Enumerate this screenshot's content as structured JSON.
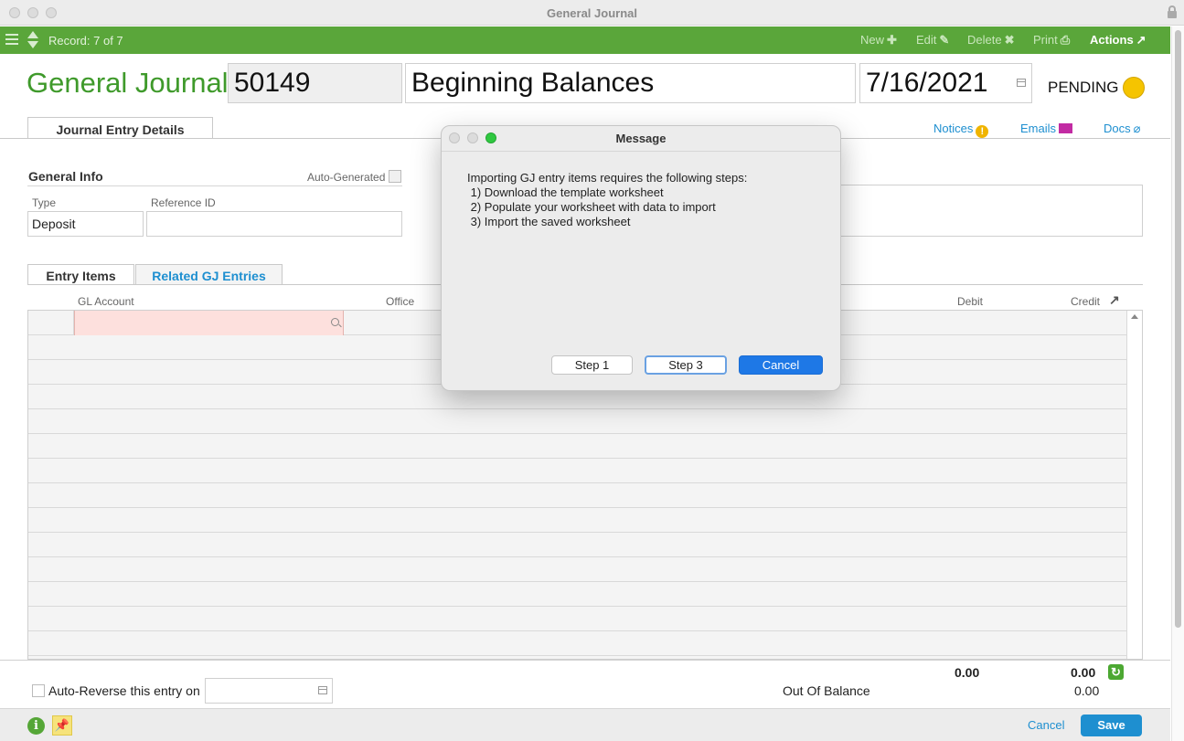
{
  "window": {
    "title": "General Journal"
  },
  "toolbar": {
    "record": "Record: 7 of 7",
    "new": "New",
    "edit": "Edit",
    "delete": "Delete",
    "print": "Print",
    "actions": "Actions"
  },
  "header": {
    "label": "General Journal:",
    "number": "50149",
    "description": "Beginning Balances",
    "date": "7/16/2021",
    "status": "PENDING",
    "status_color": "#f5c400"
  },
  "tabs": {
    "main": "Journal Entry Details"
  },
  "links": {
    "notices": "Notices",
    "emails": "Emails",
    "docs": "Docs"
  },
  "general_info": {
    "title": "General Info",
    "auto_generated_label": "Auto-Generated",
    "type_label": "Type",
    "type_value": "Deposit",
    "reference_label": "Reference ID",
    "reference_value": ""
  },
  "entry_tabs": {
    "items": "Entry Items",
    "related": "Related GJ Entries"
  },
  "columns": {
    "gl_account": "GL Account",
    "office": "Office",
    "debit": "Debit",
    "credit": "Credit"
  },
  "totals": {
    "debit": "0.00",
    "credit": "0.00"
  },
  "footer": {
    "auto_reverse_label": "Auto-Reverse this entry on",
    "out_of_balance_label": "Out Of Balance",
    "out_of_balance_value": "0.00",
    "cancel": "Cancel",
    "save": "Save"
  },
  "dialog": {
    "title": "Message",
    "lines": [
      "Importing GJ entry items requires the following steps:",
      " 1) Download the template worksheet",
      " 2) Populate your worksheet with data to import",
      " 3) Import the saved worksheet"
    ],
    "step1": "Step 1",
    "step3": "Step 3",
    "cancel": "Cancel"
  },
  "colors": {
    "brand_green": "#5aa63a",
    "link_blue": "#1e8fd0"
  }
}
